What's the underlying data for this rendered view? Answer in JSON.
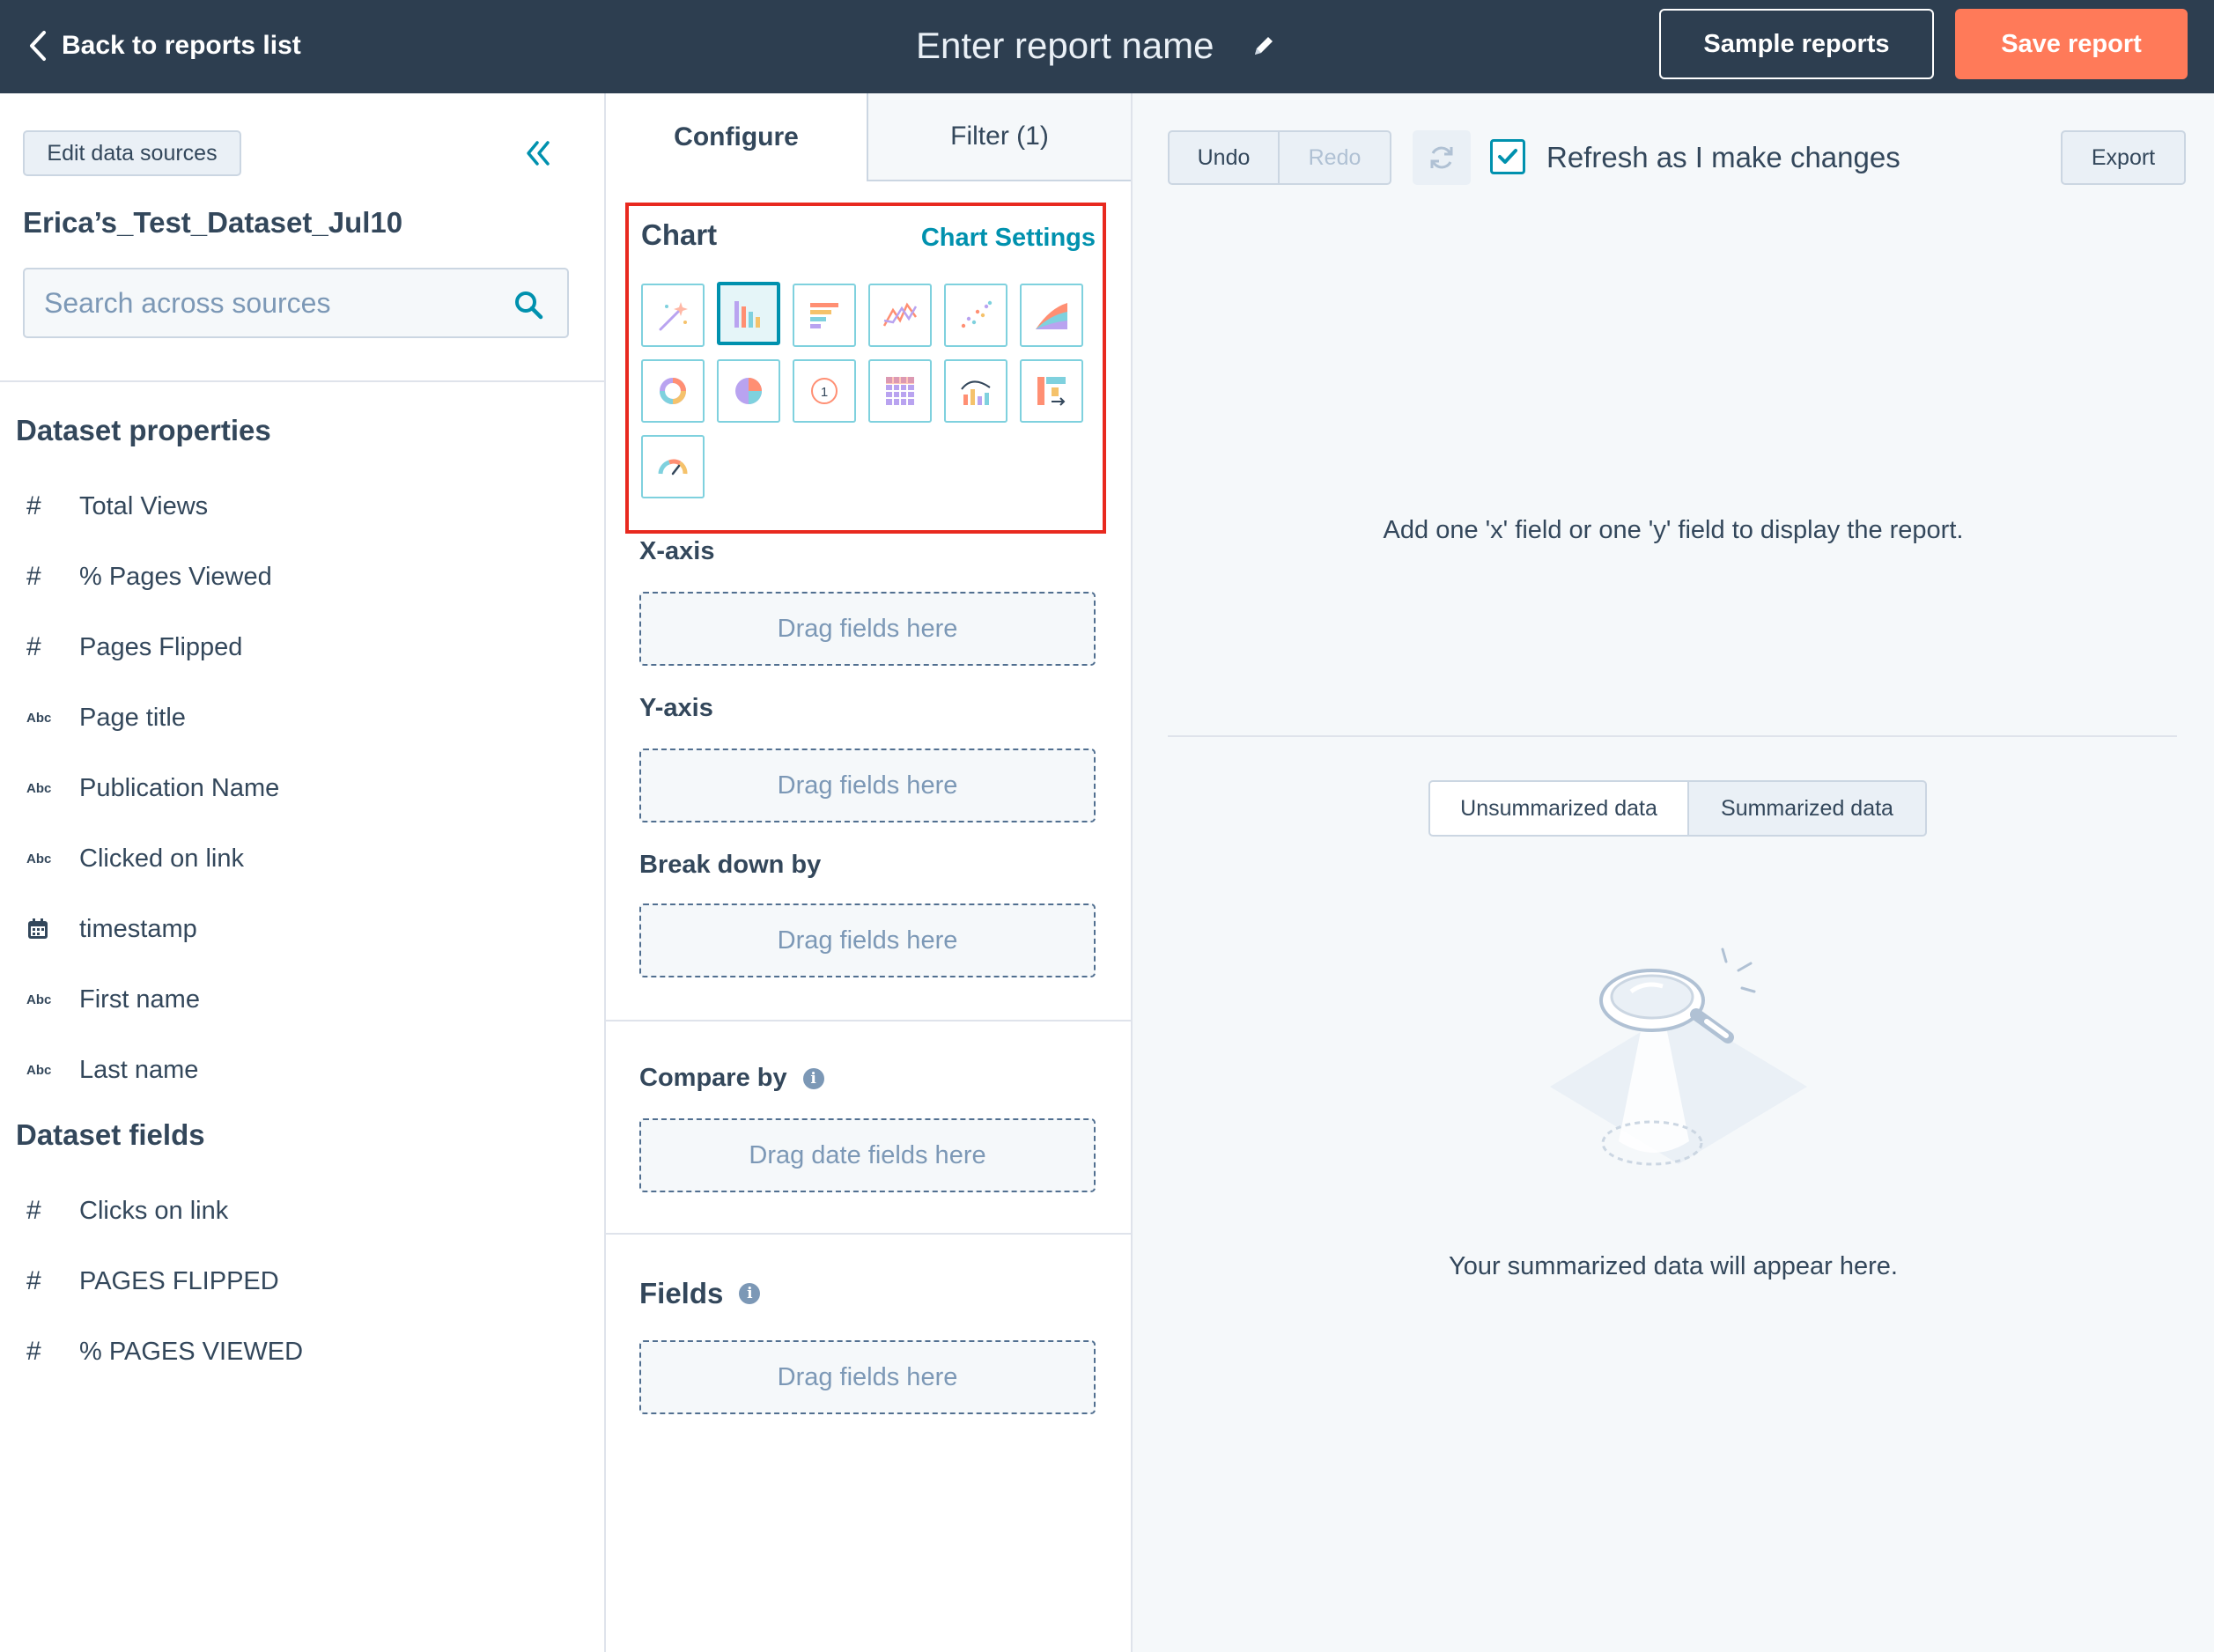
{
  "topbar": {
    "back_label": "Back to reports list",
    "report_name": "Enter report name",
    "sample_label": "Sample reports",
    "save_label": "Save report",
    "accent_color": "#ff7a59"
  },
  "sidebar": {
    "edit_label": "Edit data sources",
    "dataset_name": "Erica’s_Test_Dataset_Jul10",
    "search_placeholder": "Search across sources",
    "properties_heading": "Dataset properties",
    "properties": [
      {
        "icon": "#",
        "label": "Total Views"
      },
      {
        "icon": "#",
        "label": "% Pages Viewed"
      },
      {
        "icon": "#",
        "label": "Pages Flipped"
      },
      {
        "icon": "Abc",
        "label": "Page title"
      },
      {
        "icon": "Abc",
        "label": "Publication Name"
      },
      {
        "icon": "Abc",
        "label": "Clicked on link"
      },
      {
        "icon": "calendar-icon",
        "label": "timestamp"
      },
      {
        "icon": "Abc",
        "label": "First name"
      },
      {
        "icon": "Abc",
        "label": "Last name"
      }
    ],
    "fields_heading": "Dataset fields",
    "fields": [
      {
        "icon": "#",
        "label": "Clicks on link"
      },
      {
        "icon": "#",
        "label": "PAGES FLIPPED"
      },
      {
        "icon": "#",
        "label": "% PAGES VIEWED"
      }
    ]
  },
  "config": {
    "tab_configure": "Configure",
    "tab_filter": "Filter (1)",
    "chart_heading": "Chart",
    "chart_settings": "Chart Settings",
    "chart_types": [
      "magic-wand",
      "vertical-bar",
      "horizontal-bar",
      "line",
      "scatter",
      "area",
      "donut",
      "pie",
      "kpi",
      "pivot-table",
      "combo",
      "sankey",
      "gauge"
    ],
    "selected_chart_type": "vertical-bar",
    "xaxis_label": "X-axis",
    "yaxis_label": "Y-axis",
    "breakdown_label": "Break down by",
    "compare_label": "Compare by",
    "fields_label": "Fields",
    "drop_text": "Drag fields here",
    "drop_date_text": "Drag date fields here",
    "highlight_color": "#e8291f"
  },
  "preview": {
    "undo": "Undo",
    "redo": "Redo",
    "refresh_label": "Refresh as I make changes",
    "refresh_checked": true,
    "export": "Export",
    "empty_message": "Add one 'x' field or one 'y' field to display the report.",
    "tab_unsummarized": "Unsummarized data",
    "tab_summarized": "Summarized data",
    "summary_message": "Your summarized data will appear here."
  }
}
